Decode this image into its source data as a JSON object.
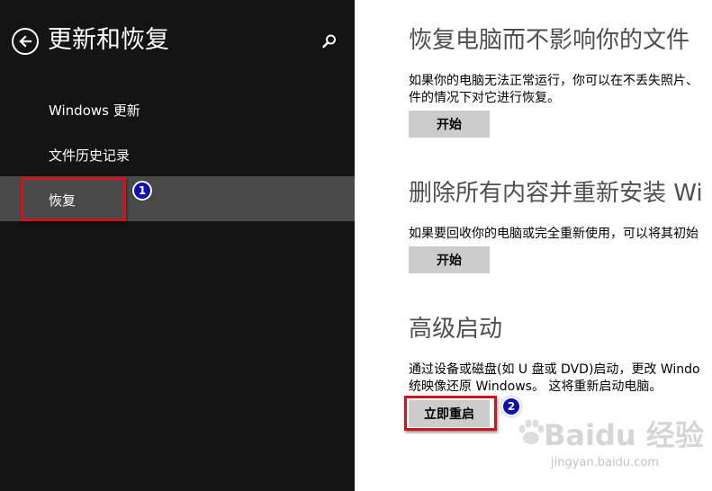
{
  "nav": {
    "title": "更新和恢复",
    "items": [
      {
        "label": "Windows 更新"
      },
      {
        "label": "文件历史记录"
      },
      {
        "label": "恢复"
      }
    ]
  },
  "sections": [
    {
      "title": "恢复电脑而不影响你的文件",
      "desc_lines": [
        "如果你的电脑无法正常运行，你可以在不丢失照片、",
        "件的情况下对它进行恢复。"
      ],
      "button": "开始"
    },
    {
      "title": "删除所有内容并重新安装 Wi",
      "desc_lines": [
        "如果要回收你的电脑或完全重新使用，可以将其初始"
      ],
      "button": "开始"
    },
    {
      "title": "高级启动",
      "desc_lines": [
        "通过设备或磁盘(如 U 盘或 DVD)启动，更改 Windo",
        "统映像还原 Windows。 这将重新启动电脑。"
      ],
      "button": "立即重启"
    }
  ],
  "annotations": {
    "step1": "1",
    "step2": "2"
  },
  "watermark": {
    "brand": "Baidu 经验",
    "url": "jingyan.baidu.com"
  },
  "colors": {
    "nav_bg": "#141414",
    "nav_selected": "#4a4a4a",
    "button_bg": "#cccccc",
    "highlight": "#d0141a"
  }
}
